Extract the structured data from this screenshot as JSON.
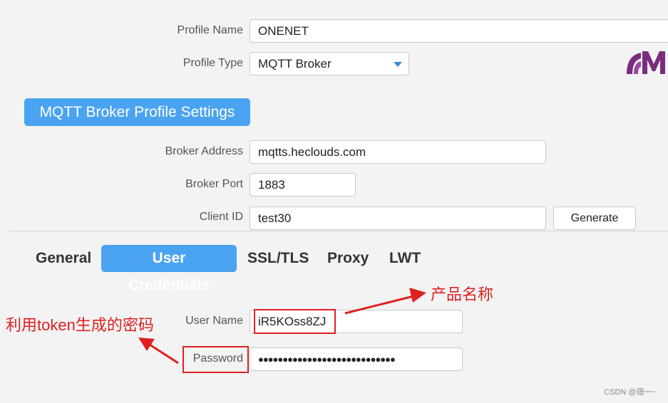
{
  "profile": {
    "name_label": "Profile Name",
    "name_value": "ONENET",
    "type_label": "Profile Type",
    "type_value": "MQTT Broker"
  },
  "section_title": "MQTT Broker Profile Settings",
  "broker": {
    "address_label": "Broker Address",
    "address_value": "mqtts.heclouds.com",
    "port_label": "Broker Port",
    "port_value": "1883",
    "client_id_label": "Client ID",
    "client_id_value": "test30",
    "generate_label": "Generate"
  },
  "tabs": [
    {
      "label": "General",
      "active": false
    },
    {
      "label": "User Credentials",
      "active": true
    },
    {
      "label": "SSL/TLS",
      "active": false
    },
    {
      "label": "Proxy",
      "active": false
    },
    {
      "label": "LWT",
      "active": false
    }
  ],
  "credentials": {
    "user_label": "User Name",
    "user_value": "iR5KOss8ZJ",
    "password_label": "Password",
    "password_value": "●●●●●●●●●●●●●●●●●●●●●●●●●●●●"
  },
  "annotations": {
    "product_name": "产品名称",
    "token_password": "利用token生成的密码"
  },
  "colors": {
    "accent": "#4aa3f0",
    "annotation": "#e02020",
    "logo": "#7a2c7e"
  },
  "watermark": "CSDN @璟一~"
}
